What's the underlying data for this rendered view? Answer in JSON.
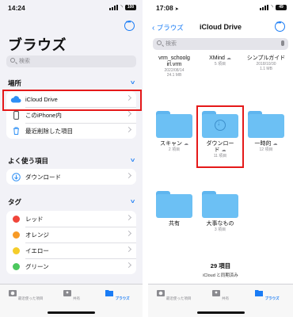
{
  "left": {
    "status": {
      "time": "14:24",
      "battery": "100"
    },
    "title": "ブラウズ",
    "search_placeholder": "検索",
    "locations": {
      "header": "場所",
      "items": [
        {
          "label": "iCloud Drive",
          "icon": "icloud-icon"
        },
        {
          "label": "このiPhone内",
          "icon": "iphone-icon"
        },
        {
          "label": "最近削除した項目",
          "icon": "trash-icon"
        }
      ]
    },
    "favorites": {
      "header": "よく使う項目",
      "items": [
        {
          "label": "ダウンロード",
          "icon": "download-circle-icon"
        }
      ]
    },
    "tags": {
      "header": "タグ",
      "items": [
        {
          "label": "レッド",
          "color": "#f0453a"
        },
        {
          "label": "オレンジ",
          "color": "#f79a26"
        },
        {
          "label": "イエロー",
          "color": "#f5cd2a"
        },
        {
          "label": "グリーン",
          "color": "#4cc85e"
        }
      ]
    },
    "tabbar": {
      "recent": "最近使った項目",
      "shared": "共有",
      "browse": "ブラウズ"
    }
  },
  "right": {
    "status": {
      "time": "17:08",
      "battery": "49"
    },
    "back_label": "ブラウズ",
    "title": "iCloud Drive",
    "search_placeholder": "検索",
    "files": [
      {
        "name1": "vrm_schoolg",
        "name2": "irl.vrm",
        "meta1": "2022/08/14",
        "meta2": "24.1 MB",
        "type": "doc"
      },
      {
        "name1": "XMind",
        "name2": "",
        "meta1": "5 項目",
        "meta2": "",
        "type": "doc"
      },
      {
        "name1": "シンプルガイド",
        "name2": "",
        "meta1": "2018/10/30",
        "meta2": "1.1 MB",
        "type": "doc"
      },
      {
        "name1": "スキャン",
        "name2": "",
        "meta1": "2 項目",
        "meta2": "",
        "type": "folder"
      },
      {
        "name1": "ダウンロー",
        "name2": "ド",
        "meta1": "11 項目",
        "meta2": "",
        "type": "download"
      },
      {
        "name1": "一時的",
        "name2": "",
        "meta1": "12 項目",
        "meta2": "",
        "type": "folder"
      },
      {
        "name1": "共有",
        "name2": "",
        "meta1": "",
        "meta2": "",
        "type": "folder"
      },
      {
        "name1": "大事なもの",
        "name2": "",
        "meta1": "3 項目",
        "meta2": "",
        "type": "folder"
      }
    ],
    "count": "29 項目",
    "sync": "iCloud と同期済み",
    "tabbar": {
      "recent": "最近使った項目",
      "shared": "共有",
      "browse": "ブラウズ"
    }
  },
  "colors": {
    "accent": "#1a7cf5",
    "highlight": "#e51919",
    "folder": "#6cc0f4"
  }
}
